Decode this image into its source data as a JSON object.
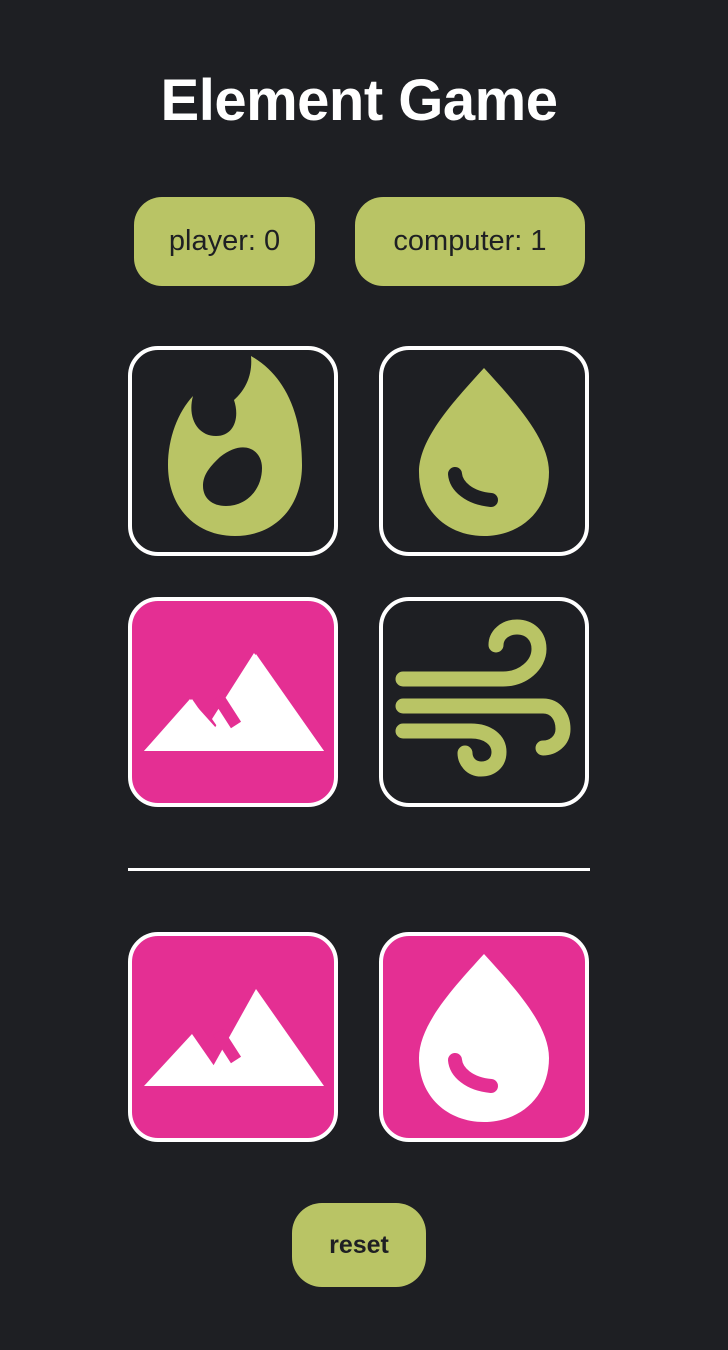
{
  "title": "Element Game",
  "scores": {
    "player_text": "player: 0",
    "computer_text": "computer: 1"
  },
  "choices": [
    {
      "element": "fire",
      "icon": "fire-icon",
      "selected": false
    },
    {
      "element": "water",
      "icon": "water-drop-icon",
      "selected": false
    },
    {
      "element": "earth",
      "icon": "mountain-icon",
      "selected": true
    },
    {
      "element": "air",
      "icon": "wind-icon",
      "selected": false
    }
  ],
  "result": {
    "player_choice": {
      "element": "earth",
      "icon": "mountain-icon"
    },
    "computer_choice": {
      "element": "water",
      "icon": "water-drop-icon"
    }
  },
  "reset_label": "reset",
  "colors": {
    "background": "#1e1f23",
    "accent_green": "#b9c465",
    "accent_pink": "#e42f93",
    "border": "#ffffff"
  }
}
